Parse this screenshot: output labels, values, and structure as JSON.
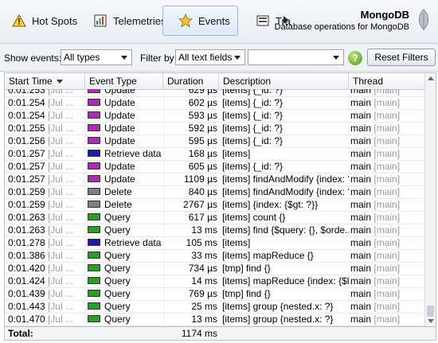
{
  "toolbar": {
    "tabs": [
      {
        "label": "Hot Spots",
        "icon": "warning-icon"
      },
      {
        "label": "Telemetries",
        "icon": "telemetry-icon"
      },
      {
        "label": "Events",
        "icon": "star-icon",
        "active": true
      },
      {
        "label": "Tra",
        "icon": "transactions-icon"
      }
    ],
    "title": "MongoDB",
    "subtitle": "Database operations for MongoDB"
  },
  "filters": {
    "show_events_label": "Show events:",
    "show_events_value": "All types",
    "filter_by_label": "Filter by",
    "filter_by_value": "All text fields",
    "filter_text_value": "",
    "help_label": "?",
    "reset_label": "Reset Filters"
  },
  "table": {
    "columns": [
      "Start Time",
      "Event Type",
      "Duration",
      "Description",
      "Thread"
    ],
    "sort_column": "Start Time",
    "rows": [
      {
        "time": "0:01.253",
        "time_ext": "[Jul ...",
        "type": "Update",
        "color": "#b02ab8",
        "duration": "629 µs",
        "desc": "[items] {_id: ?}",
        "thread": "main",
        "thread_ext": "[main]"
      },
      {
        "time": "0:01.254",
        "time_ext": "[Jul ...",
        "type": "Update",
        "color": "#b02ab8",
        "duration": "602 µs",
        "desc": "[items] {_id: ?}",
        "thread": "main",
        "thread_ext": "[main]"
      },
      {
        "time": "0:01.254",
        "time_ext": "[Jul ...",
        "type": "Update",
        "color": "#b02ab8",
        "duration": "593 µs",
        "desc": "[items] {_id: ?}",
        "thread": "main",
        "thread_ext": "[main]"
      },
      {
        "time": "0:01.255",
        "time_ext": "[Jul ...",
        "type": "Update",
        "color": "#b02ab8",
        "duration": "592 µs",
        "desc": "[items] {_id: ?}",
        "thread": "main",
        "thread_ext": "[main]"
      },
      {
        "time": "0:01.256",
        "time_ext": "[Jul ...",
        "type": "Update",
        "color": "#b02ab8",
        "duration": "595 µs",
        "desc": "[items] {_id: ?}",
        "thread": "main",
        "thread_ext": "[main]"
      },
      {
        "time": "0:01.257",
        "time_ext": "[Jul ...",
        "type": "Retrieve data",
        "color": "#1c1cb4",
        "duration": "168 µs",
        "desc": "[items]",
        "thread": "main",
        "thread_ext": "[main]"
      },
      {
        "time": "0:01.257",
        "time_ext": "[Jul ...",
        "type": "Update",
        "color": "#b02ab8",
        "duration": "605 µs",
        "desc": "[items] {_id: ?}",
        "thread": "main",
        "thread_ext": "[main]"
      },
      {
        "time": "0:01.257",
        "time_ext": "[Jul ...",
        "type": "Update",
        "color": "#b02ab8",
        "duration": "1109 µs",
        "desc": "[items] findAndModify {index: ?}",
        "thread": "main",
        "thread_ext": "[main]"
      },
      {
        "time": "0:01.259",
        "time_ext": "[Jul ...",
        "type": "Delete",
        "color": "#808080",
        "duration": "840 µs",
        "desc": "[items] findAndModify {index: ?}",
        "thread": "main",
        "thread_ext": "[main]"
      },
      {
        "time": "0:01.259",
        "time_ext": "[Jul ...",
        "type": "Delete",
        "color": "#808080",
        "duration": "2767 µs",
        "desc": "[items] {index: {$gt: ?}}",
        "thread": "main",
        "thread_ext": "[main]"
      },
      {
        "time": "0:01.263",
        "time_ext": "[Jul ...",
        "type": "Query",
        "color": "#22a422",
        "duration": "617 µs",
        "desc": "[items] count {}",
        "thread": "main",
        "thread_ext": "[main]"
      },
      {
        "time": "0:01.263",
        "time_ext": "[Jul ...",
        "type": "Query",
        "color": "#22a422",
        "duration": "13 ms",
        "desc": "[items] find {$query: {}, $orde...",
        "thread": "main",
        "thread_ext": "[main]"
      },
      {
        "time": "0:01.278",
        "time_ext": "[Jul ...",
        "type": "Retrieve data",
        "color": "#1c1cb4",
        "duration": "105 ms",
        "desc": "[items]",
        "thread": "main",
        "thread_ext": "[main]"
      },
      {
        "time": "0:01.386",
        "time_ext": "[Jul ...",
        "type": "Query",
        "color": "#22a422",
        "duration": "33 ms",
        "desc": "[items] mapReduce {}",
        "thread": "main",
        "thread_ext": "[main]"
      },
      {
        "time": "0:01.420",
        "time_ext": "[Jul ...",
        "type": "Query",
        "color": "#22a422",
        "duration": "734 µs",
        "desc": "[tmp] find {}",
        "thread": "main",
        "thread_ext": "[main]"
      },
      {
        "time": "0:01.424",
        "time_ext": "[Jul ...",
        "type": "Query",
        "color": "#22a422",
        "duration": "14 ms",
        "desc": "[items] mapReduce {index: {$l...",
        "thread": "main",
        "thread_ext": "[main]"
      },
      {
        "time": "0:01.439",
        "time_ext": "[Jul ...",
        "type": "Query",
        "color": "#22a422",
        "duration": "769 µs",
        "desc": "[tmp] find {}",
        "thread": "main",
        "thread_ext": "[main]"
      },
      {
        "time": "0:01.443",
        "time_ext": "[Jul ...",
        "type": "Query",
        "color": "#22a422",
        "duration": "25 ms",
        "desc": "[items] group {nested.x: ?}",
        "thread": "main",
        "thread_ext": "[main]"
      },
      {
        "time": "0:01.470",
        "time_ext": "[Jul ...",
        "type": "Query",
        "color": "#22a422",
        "duration": "13 ms",
        "desc": "[items] group {nested.x: ?}",
        "thread": "main",
        "thread_ext": "[main]"
      }
    ],
    "total_label": "Total:",
    "total_value": "1174 ms"
  }
}
